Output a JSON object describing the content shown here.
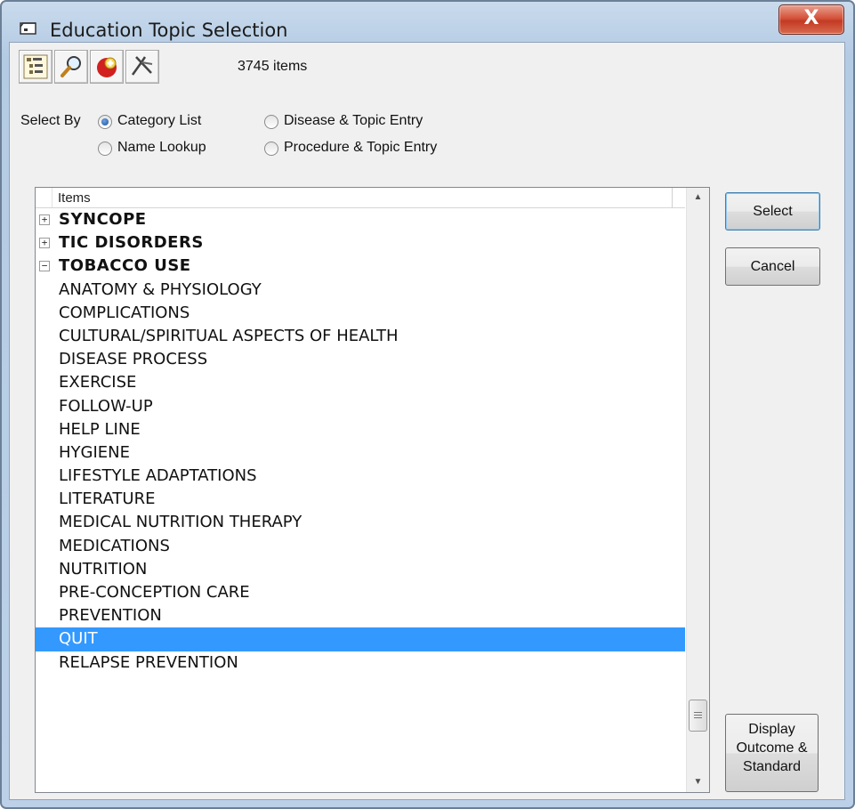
{
  "window": {
    "title": "Education Topic Selection",
    "close_glyph": "X"
  },
  "toolbar": {
    "icons": [
      "tree-view-icon",
      "magnifier-icon",
      "add-red-icon",
      "tools-icon"
    ],
    "item_count": "3745 items"
  },
  "select_by": {
    "label": "Select By",
    "options": [
      {
        "label": "Category List",
        "checked": true
      },
      {
        "label": "Disease & Topic Entry",
        "checked": false
      },
      {
        "label": "Name Lookup",
        "checked": false
      },
      {
        "label": "Procedure & Topic Entry",
        "checked": false
      }
    ]
  },
  "list": {
    "header": "Items",
    "rows": [
      {
        "label": "SYNCOPE",
        "expander": "+",
        "bold": true
      },
      {
        "label": "TIC DISORDERS",
        "expander": "+",
        "bold": true
      },
      {
        "label": "TOBACCO USE",
        "expander": "−",
        "bold": true
      },
      {
        "label": "ANATOMY & PHYSIOLOGY"
      },
      {
        "label": "COMPLICATIONS"
      },
      {
        "label": "CULTURAL/SPIRITUAL ASPECTS OF HEALTH"
      },
      {
        "label": "DISEASE PROCESS"
      },
      {
        "label": "EXERCISE"
      },
      {
        "label": "FOLLOW-UP"
      },
      {
        "label": "HELP LINE"
      },
      {
        "label": "HYGIENE"
      },
      {
        "label": "LIFESTYLE ADAPTATIONS"
      },
      {
        "label": "LITERATURE"
      },
      {
        "label": "MEDICAL NUTRITION THERAPY"
      },
      {
        "label": "MEDICATIONS"
      },
      {
        "label": "NUTRITION"
      },
      {
        "label": "PRE-CONCEPTION CARE"
      },
      {
        "label": "PREVENTION"
      },
      {
        "label": "QUIT",
        "selected": true
      },
      {
        "label": "RELAPSE PREVENTION"
      }
    ]
  },
  "buttons": {
    "select": "Select",
    "cancel": "Cancel",
    "display_lines": [
      "Display",
      "Outcome &",
      "Standard"
    ]
  },
  "colors": {
    "selection": "#3399ff",
    "title_gradient_top": "#c9daec",
    "close_red": "#c33a24"
  }
}
